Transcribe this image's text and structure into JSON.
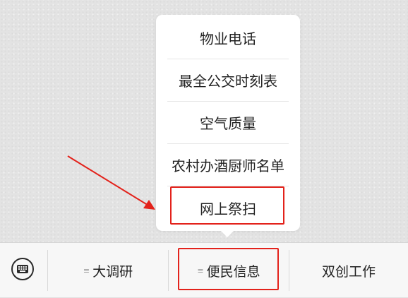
{
  "popup_menu": {
    "items": [
      {
        "label": "物业电话"
      },
      {
        "label": "最全公交时刻表"
      },
      {
        "label": "空气质量"
      },
      {
        "label": "农村办酒厨师名单"
      },
      {
        "label": "网上祭扫"
      }
    ]
  },
  "tabbar": {
    "tabs": [
      {
        "label": "大调研",
        "has_submenu": true
      },
      {
        "label": "便民信息",
        "has_submenu": true
      },
      {
        "label": "双创工作",
        "has_submenu": false
      }
    ]
  },
  "icons": {
    "keyboard": "keyboard-icon",
    "submenu": "menu-lines-icon"
  },
  "colors": {
    "annotation_red": "#e3221b",
    "tabbar_bg": "#f7f7f7",
    "popup_bg": "#ffffff",
    "text": "#222222"
  }
}
